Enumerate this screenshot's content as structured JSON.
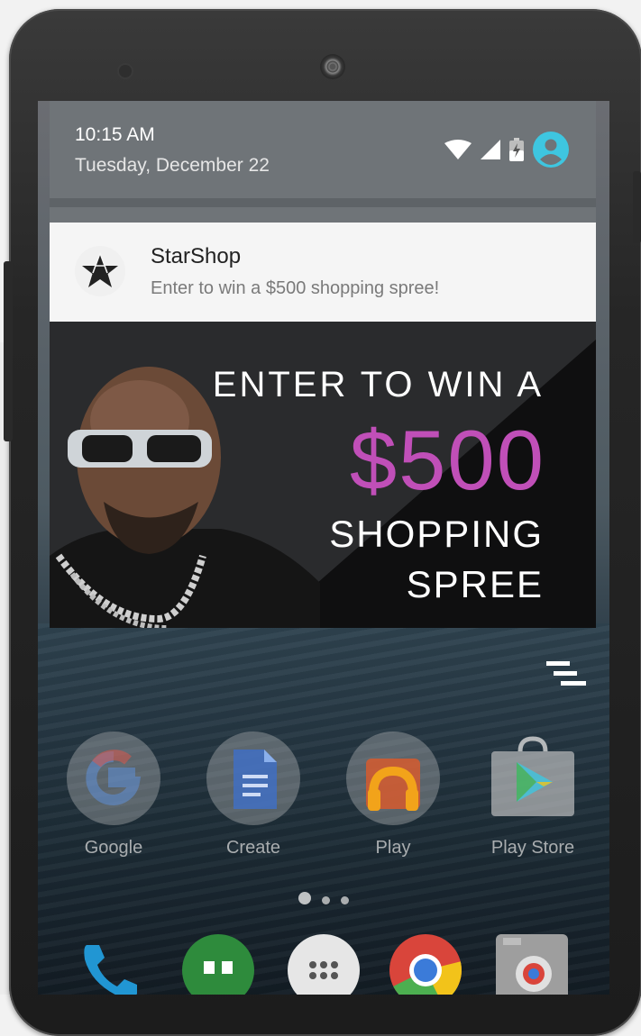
{
  "status_shade": {
    "time": "10:15 AM",
    "date": "Tuesday, December 22",
    "icons": [
      "wifi-icon",
      "signal-icon",
      "battery-charging-icon",
      "account-icon"
    ],
    "account_color": "#3ec6e0"
  },
  "notification": {
    "app_name": "StarShop",
    "text": "Enter to win a $500 shopping spree!",
    "icon": "star-icon"
  },
  "promo": {
    "line1": "ENTER TO WIN A",
    "amount": "$500",
    "line2": "SHOPPING",
    "line3": "SPREE",
    "amount_color": "#c04fb8"
  },
  "home": {
    "apps": [
      {
        "label": "Google",
        "icon": "google-icon"
      },
      {
        "label": "Create",
        "icon": "docs-icon"
      },
      {
        "label": "Play",
        "icon": "play-music-icon"
      },
      {
        "label": "Play Store",
        "icon": "play-store-icon"
      }
    ],
    "dock": [
      "phone-icon",
      "hangouts-icon",
      "app-drawer-icon",
      "chrome-icon",
      "camera-icon"
    ]
  }
}
